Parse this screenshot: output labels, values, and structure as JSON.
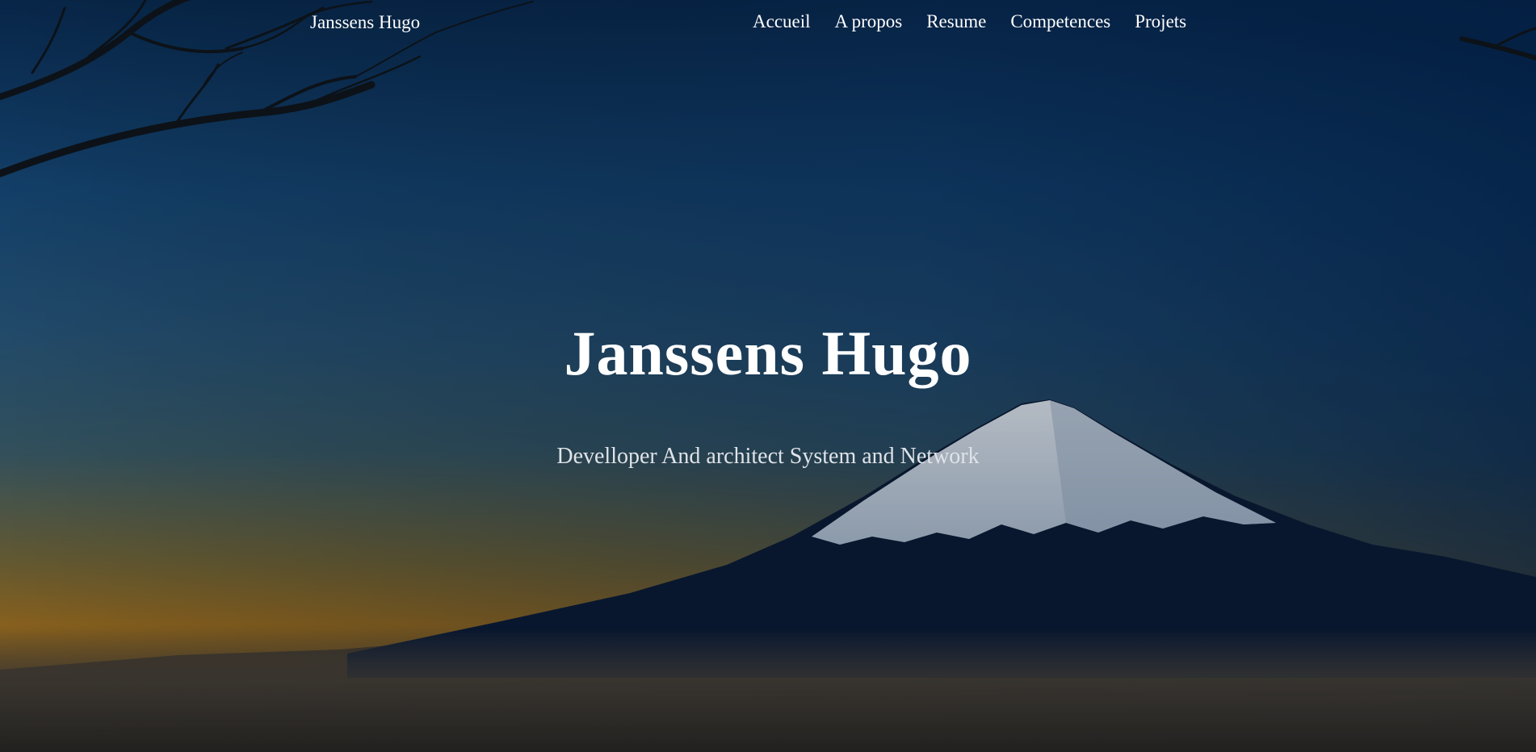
{
  "navbar": {
    "brand": "Janssens Hugo",
    "links": [
      {
        "label": "Accueil"
      },
      {
        "label": "A propos"
      },
      {
        "label": "Resume"
      },
      {
        "label": "Competences"
      },
      {
        "label": "Projets"
      }
    ]
  },
  "hero": {
    "title": "Janssens Hugo",
    "subtitle": "Develloper And architect System and Network",
    "background_image": "mountain-landscape-at-dusk"
  },
  "colors": {
    "text": "#ffffff",
    "subtitle_text": "#dfe3e8",
    "sky_top": "#0b3a6e",
    "horizon_glow": "#b0781c"
  }
}
